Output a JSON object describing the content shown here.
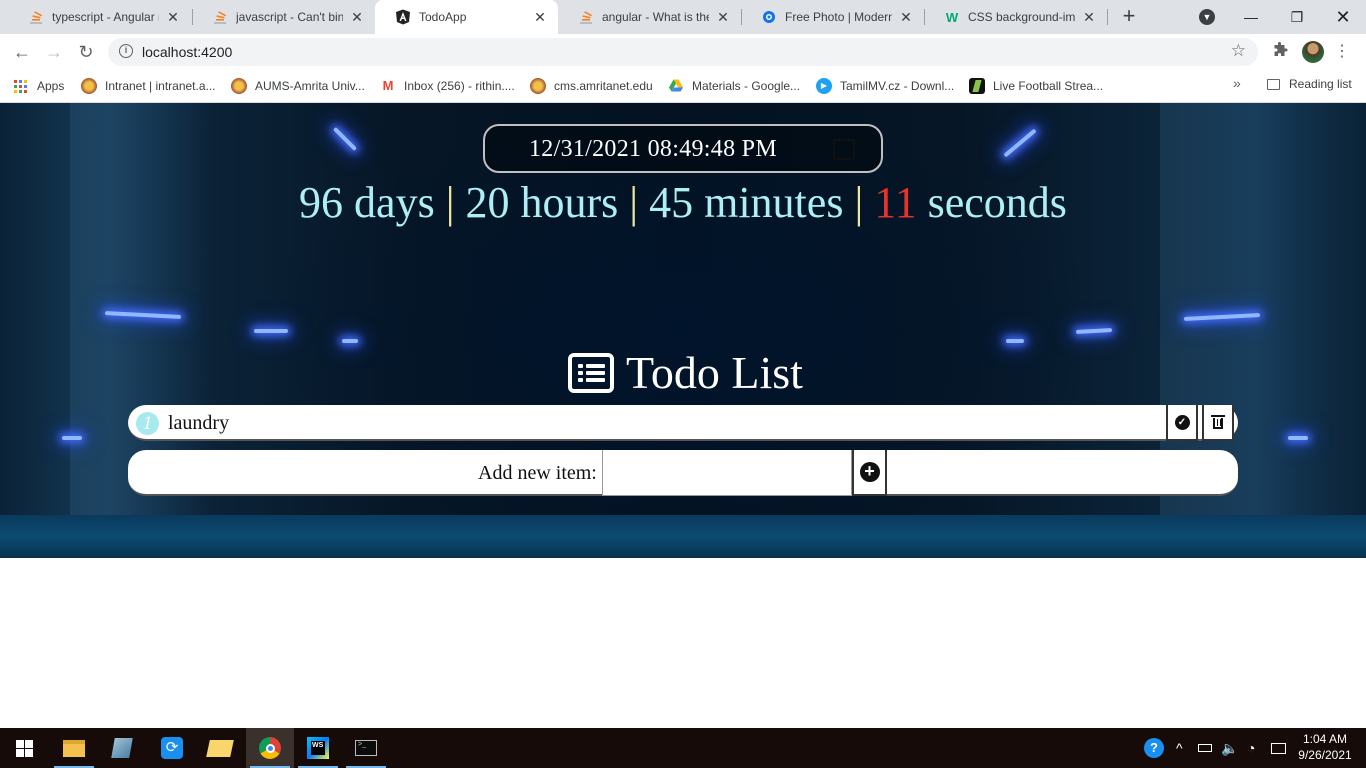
{
  "browser": {
    "tabs": [
      {
        "title": "typescript - Angular ng",
        "icon": "stackoverflow-icon",
        "active": false
      },
      {
        "title": "javascript - Can't bind",
        "icon": "stackoverflow-icon",
        "active": false
      },
      {
        "title": "TodoApp",
        "icon": "angular-icon",
        "active": true
      },
      {
        "title": "angular - What is the",
        "icon": "stackoverflow-icon",
        "active": false
      },
      {
        "title": "Free Photo | Modern fu",
        "icon": "freepik-icon",
        "active": false
      },
      {
        "title": "CSS background-imag",
        "icon": "w3schools-icon",
        "active": false
      }
    ],
    "url": "localhost:4200",
    "bookmarks": [
      {
        "label": "Apps",
        "icon": "apps-grid-icon"
      },
      {
        "label": "Intranet | intranet.a...",
        "icon": "amrita-icon"
      },
      {
        "label": "AUMS-Amrita Univ...",
        "icon": "amrita-icon"
      },
      {
        "label": "Inbox (256) - rithin....",
        "icon": "gmail-icon"
      },
      {
        "label": "cms.amritanet.edu",
        "icon": "amrita-icon"
      },
      {
        "label": "Materials - Google...",
        "icon": "google-drive-icon"
      },
      {
        "label": "TamilMV.cz - Downl...",
        "icon": "play-icon"
      },
      {
        "label": "Live Football Strea...",
        "icon": "football-icon"
      }
    ],
    "reading_list": "Reading list",
    "more_bookmarks": "»"
  },
  "app": {
    "datetime_value": "12/31/2021 08:49:48 PM",
    "countdown": {
      "days": "96 days",
      "hours": "20 hours",
      "minutes": "45 minutes",
      "seconds_num": "11",
      "seconds_label": "seconds",
      "separator": "|"
    },
    "todo_title": "Todo List",
    "items": [
      {
        "index": "1",
        "text": "laundry"
      }
    ],
    "add_label": "Add new item:",
    "add_placeholder": ""
  },
  "taskbar": {
    "time": "1:04 AM",
    "date": "9/26/2021"
  },
  "colors": {
    "countdown_text": "#aeeff5",
    "countdown_seconds": "#e8332c",
    "item_badge": "#a8e9ee"
  }
}
